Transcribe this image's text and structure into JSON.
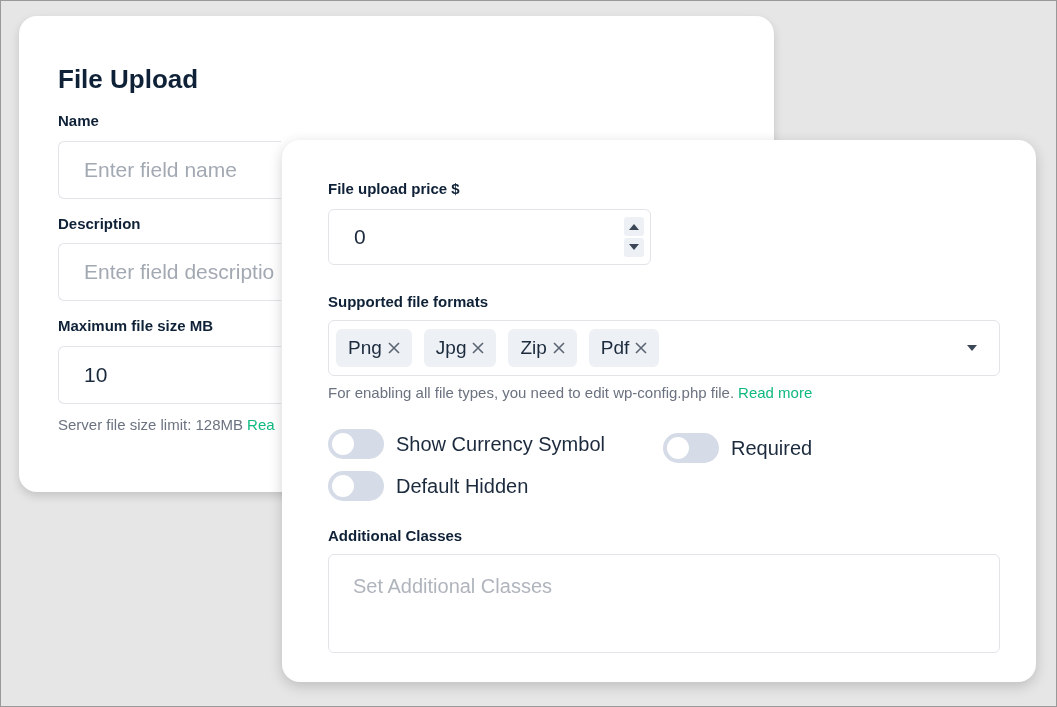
{
  "back_card": {
    "title": "File Upload",
    "fields": [
      {
        "label": "Name",
        "placeholder": "Enter field name"
      },
      {
        "label": "Description",
        "placeholder": "Enter field descriptio"
      },
      {
        "label": "Maximum file size MB",
        "value": "10"
      }
    ],
    "helper": {
      "text": "Server file size limit: 128MB",
      "link": "Rea"
    }
  },
  "front_card": {
    "price": {
      "label": "File upload price $",
      "value": "0"
    },
    "formats": {
      "label": "Supported file formats",
      "tags": [
        "Png",
        "Jpg",
        "Zip",
        "Pdf"
      ],
      "helper": "For enabling all file types, you need to edit wp-config.php file.",
      "link": "Read more"
    },
    "toggles": [
      {
        "label": "Show Currency Symbol",
        "on": false
      },
      {
        "label": "Default Hidden",
        "on": false
      },
      {
        "label": "Required",
        "on": false
      }
    ],
    "classes": {
      "label": "Additional Classes",
      "placeholder": "Set Additional Classes"
    }
  }
}
